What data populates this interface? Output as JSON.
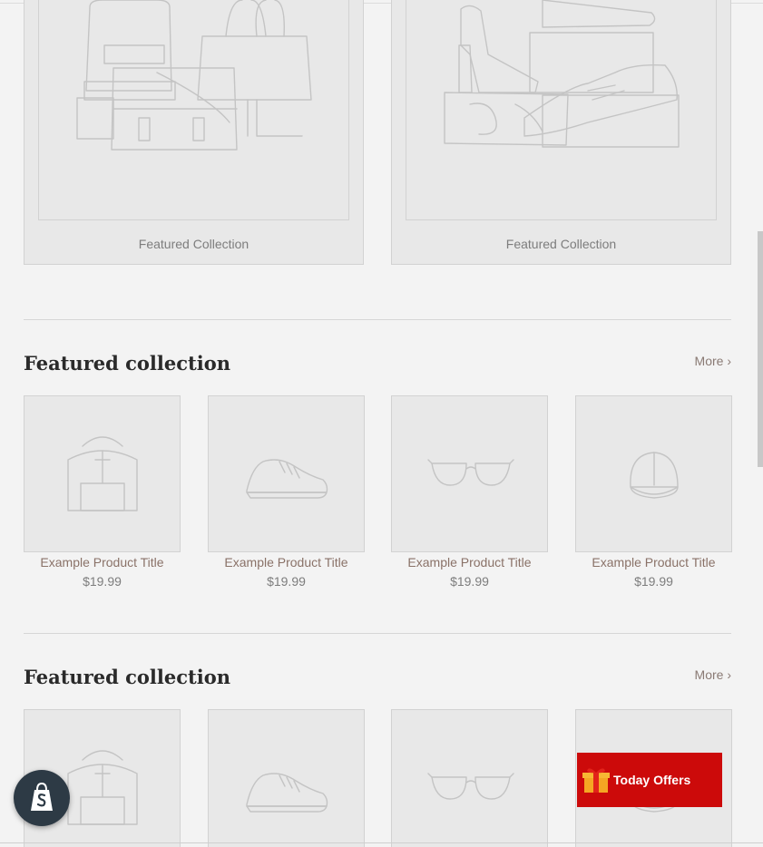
{
  "collections_grid": {
    "items": [
      {
        "caption": "Featured Collection",
        "icon": "bags-illustration-icon"
      },
      {
        "caption": "Featured Collection",
        "icon": "shoes-illustration-icon"
      }
    ]
  },
  "sections": [
    {
      "title": "Featured collection",
      "more_label": "More ›",
      "products": [
        {
          "title": "Example Product Title",
          "price": "$19.99",
          "icon": "backpack-icon"
        },
        {
          "title": "Example Product Title",
          "price": "$19.99",
          "icon": "sneaker-icon"
        },
        {
          "title": "Example Product Title",
          "price": "$19.99",
          "icon": "glasses-icon"
        },
        {
          "title": "Example Product Title",
          "price": "$19.99",
          "icon": "cap-icon"
        }
      ]
    },
    {
      "title": "Featured collection",
      "more_label": "More ›",
      "products": [
        {
          "icon": "backpack-icon"
        },
        {
          "icon": "sneaker-icon"
        },
        {
          "icon": "glasses-icon"
        },
        {
          "icon": "cap-icon"
        }
      ]
    }
  ],
  "offers_button": {
    "label": "Today Offers",
    "icon": "gift-icon",
    "color": "#cc0a0a"
  },
  "shopify_badge": {
    "icon": "shopify-bag-icon",
    "color": "#2d3a45"
  }
}
